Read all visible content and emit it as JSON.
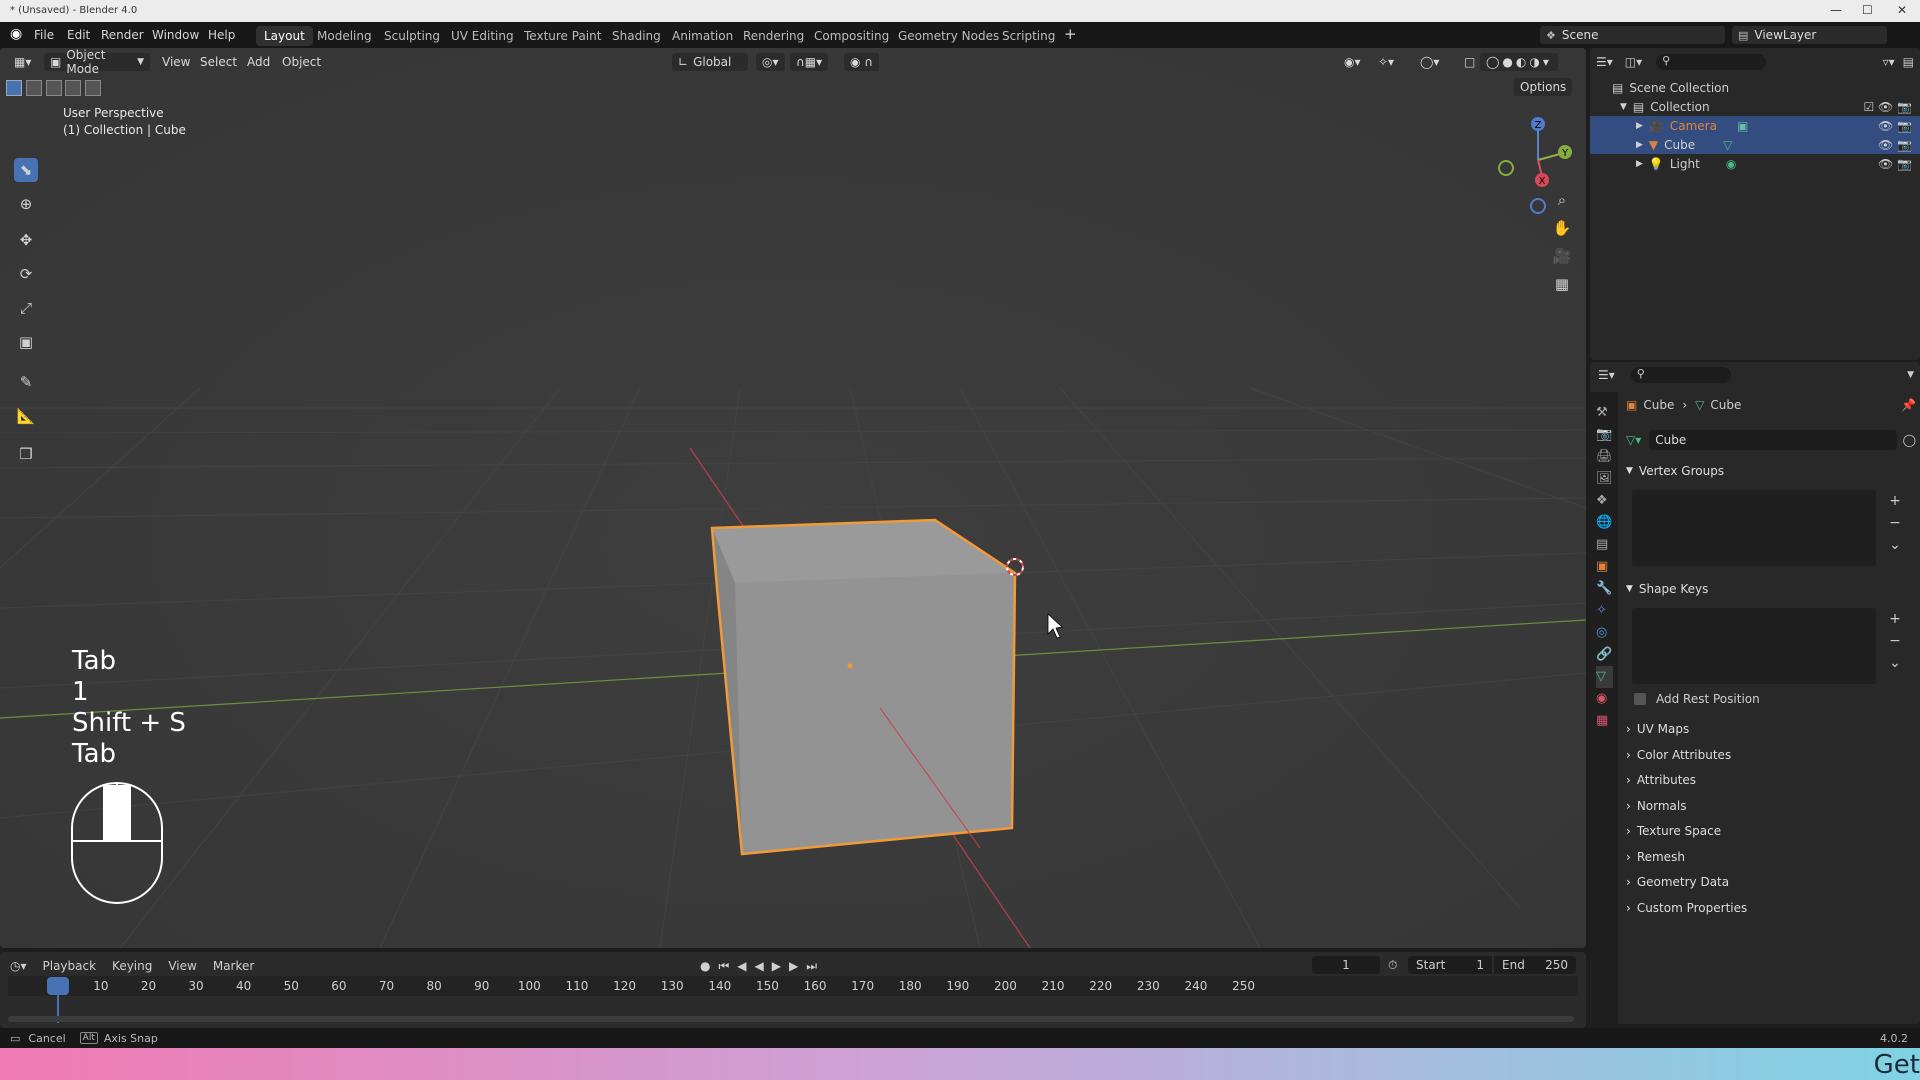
{
  "window": {
    "title": "* (Unsaved) - Blender 4.0"
  },
  "menu": [
    "File",
    "Edit",
    "Render",
    "Window",
    "Help"
  ],
  "workspaces": [
    "Layout",
    "Modeling",
    "Sculpting",
    "UV Editing",
    "Texture Paint",
    "Shading",
    "Animation",
    "Rendering",
    "Compositing",
    "Geometry Nodes",
    "Scripting"
  ],
  "active_workspace": "Layout",
  "scene": {
    "name": "Scene",
    "view_layer": "ViewLayer"
  },
  "viewport": {
    "mode": "Object Mode",
    "menus": [
      "View",
      "Select",
      "Add",
      "Object"
    ],
    "transform_orientation": "Global",
    "options_label": "Options",
    "overlay_line1": "User Perspective",
    "overlay_line2": "(1) Collection | Cube",
    "gizmo_axes": {
      "z": "Z",
      "x": "X",
      "y": "Y"
    }
  },
  "keycast": [
    "Tab",
    "1",
    "Shift + S",
    "Tab"
  ],
  "outliner": {
    "root": "Scene Collection",
    "collection": "Collection",
    "items": [
      {
        "name": "Camera",
        "color": "#e0813b"
      },
      {
        "name": "Cube",
        "color": "#d5d5d5"
      },
      {
        "name": "Light",
        "color": "#d5d5d5"
      }
    ]
  },
  "properties": {
    "breadcrumb_object": "Cube",
    "breadcrumb_data": "Cube",
    "mesh_name": "Cube",
    "sections_open": [
      "Vertex Groups",
      "Shape Keys"
    ],
    "add_rest_position": "Add Rest Position",
    "sections_closed": [
      "UV Maps",
      "Color Attributes",
      "Attributes",
      "Normals",
      "Texture Space",
      "Remesh",
      "Geometry Data",
      "Custom Properties"
    ]
  },
  "timeline": {
    "menus": [
      "Playback",
      "Keying",
      "View",
      "Marker"
    ],
    "current_frame": "1",
    "start_label": "Start",
    "start": "1",
    "end_label": "End",
    "end": "250",
    "ticks": [
      "1",
      "10",
      "20",
      "30",
      "40",
      "50",
      "60",
      "70",
      "80",
      "90",
      "100",
      "110",
      "120",
      "130",
      "140",
      "150",
      "160",
      "170",
      "180",
      "190",
      "200",
      "210",
      "220",
      "230",
      "240",
      "250"
    ]
  },
  "statusbar": {
    "cancel": "Cancel",
    "alt_key": "Alt",
    "axis_snap": "Axis Snap",
    "version": "4.0.2"
  },
  "overlay_text": "Get",
  "colors": {
    "selection_outline": "#f29a38",
    "accent": "#4772b3",
    "x_axis": "#c9404c",
    "y_axis": "#7aa33a"
  }
}
